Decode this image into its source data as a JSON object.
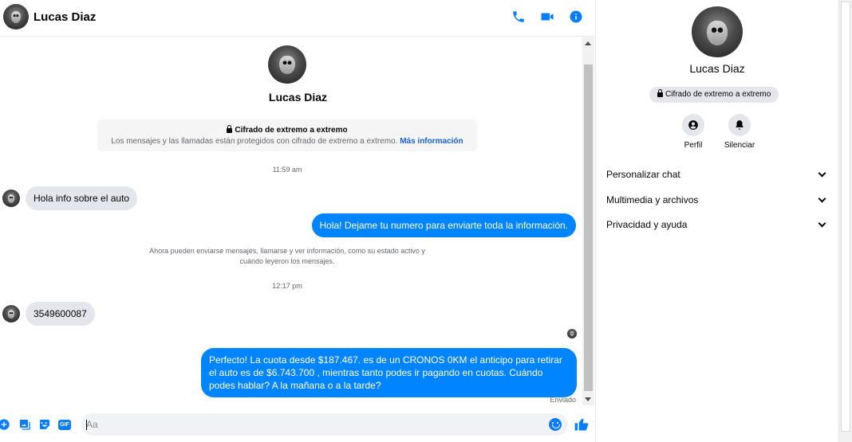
{
  "header": {
    "name": "Lucas Diaz",
    "icons": [
      "phone-icon",
      "video-camera-icon",
      "info-icon"
    ]
  },
  "intro": {
    "name": "Lucas Diaz",
    "e2e_title": "Cifrado de extremo a extremo",
    "e2e_text": "Los mensajes y las llamadas están protegidos con cifrado de extremo a extremo.",
    "e2e_link": "Más información"
  },
  "messages": {
    "time1": "11:59 am",
    "msg1": "Hola info sobre el auto",
    "msg2": "Hola! Dejame tu numero  para enviarte toda la información.",
    "system_note": "Ahora pueden enviarse mensajes, llamarse y ver información, como su estado activo y cuándo leyeron los mensajes.",
    "time2": "12:17 pm",
    "msg3": "3549600087",
    "msg4": "Perfecto! La cuota desde $187.467. es de un CRONOS 0KM el anticipo para retirar el auto es de $6.743.700 , mientras tanto podes ir pagando en cuotas. Cuándo podes hablar? A la mañana o a la tarde?",
    "status": "Enviado"
  },
  "composer": {
    "placeholder": "Aa",
    "gif_label": "GIF"
  },
  "info_panel": {
    "name": "Lucas Diaz",
    "e2e_badge": "Cifrado de extremo a extremo",
    "actions": [
      {
        "label": "Perfil",
        "icon": "profile-icon"
      },
      {
        "label": "Silenciar",
        "icon": "bell-icon"
      }
    ],
    "sections": [
      {
        "label": "Personalizar chat"
      },
      {
        "label": "Multimedia y archivos"
      },
      {
        "label": "Privacidad y ayuda"
      }
    ]
  },
  "colors": {
    "accent": "#0a7cff",
    "outgoing_bubble": "#0084ff",
    "incoming_bubble": "#e4e6eb"
  }
}
